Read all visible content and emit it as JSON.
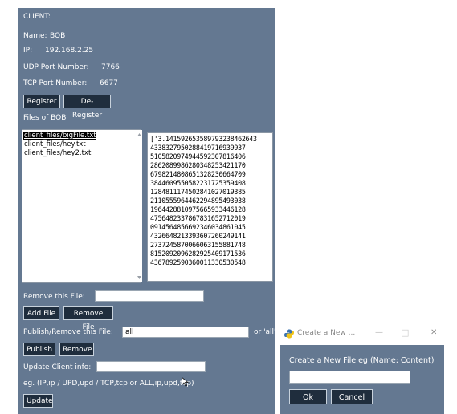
{
  "client": {
    "header": "CLIENT:",
    "name_label": "Name:",
    "name_value": "BOB",
    "ip_label": "IP:",
    "ip_value": "192.168.2.25",
    "udp_label": "UDP Port Number:",
    "udp_value": "7766",
    "tcp_label": "TCP Port Number:",
    "tcp_value": "6677"
  },
  "buttons": {
    "register": "Register",
    "deregister": "De-Register",
    "add_file": "Add File",
    "remove_file": "Remove File",
    "publish": "Publish",
    "remove": "Remove",
    "update": "Update"
  },
  "files": {
    "label": "Files of BOB",
    "items": [
      "client_files/bigFile.txt",
      "client_files/hey.txt",
      "client_files/hey2.txt"
    ],
    "selected_index": 0
  },
  "content": {
    "lines": [
      "['3.141592653589793238462643",
      "4338327950288419716939937",
      "5105820974944592307816406",
      "2862089986280348253421170",
      "6798214808651328230664709",
      "3844609550582231725359408",
      "1284811174502841027019385",
      "2110555964462294895493038",
      "1964428810975665933446128",
      "4756482337867831652712019",
      "0914564856692346034861045",
      "4326648213393607260249141",
      "2737245870066063155881748",
      "8152092096282925409171536",
      "4367892590360011330530548"
    ]
  },
  "form": {
    "remove_label": "Remove this File:",
    "remove_value": "",
    "publish_label": "Publish/Remove this File:",
    "publish_value": "all",
    "or_all": "or 'all'",
    "update_label": "Update Client info:",
    "update_value": "",
    "hint": "eg. (IP,ip / UPD,upd / TCP,tcp or ALL,ip,upd,tcp)"
  },
  "dialog": {
    "title": "Create a New ...",
    "prompt": "Create a New File eg.(Name: Content)",
    "input_value": "",
    "ok": "Ok",
    "cancel": "Cancel",
    "minimize": "—",
    "maximize": "□",
    "close": "✕"
  }
}
